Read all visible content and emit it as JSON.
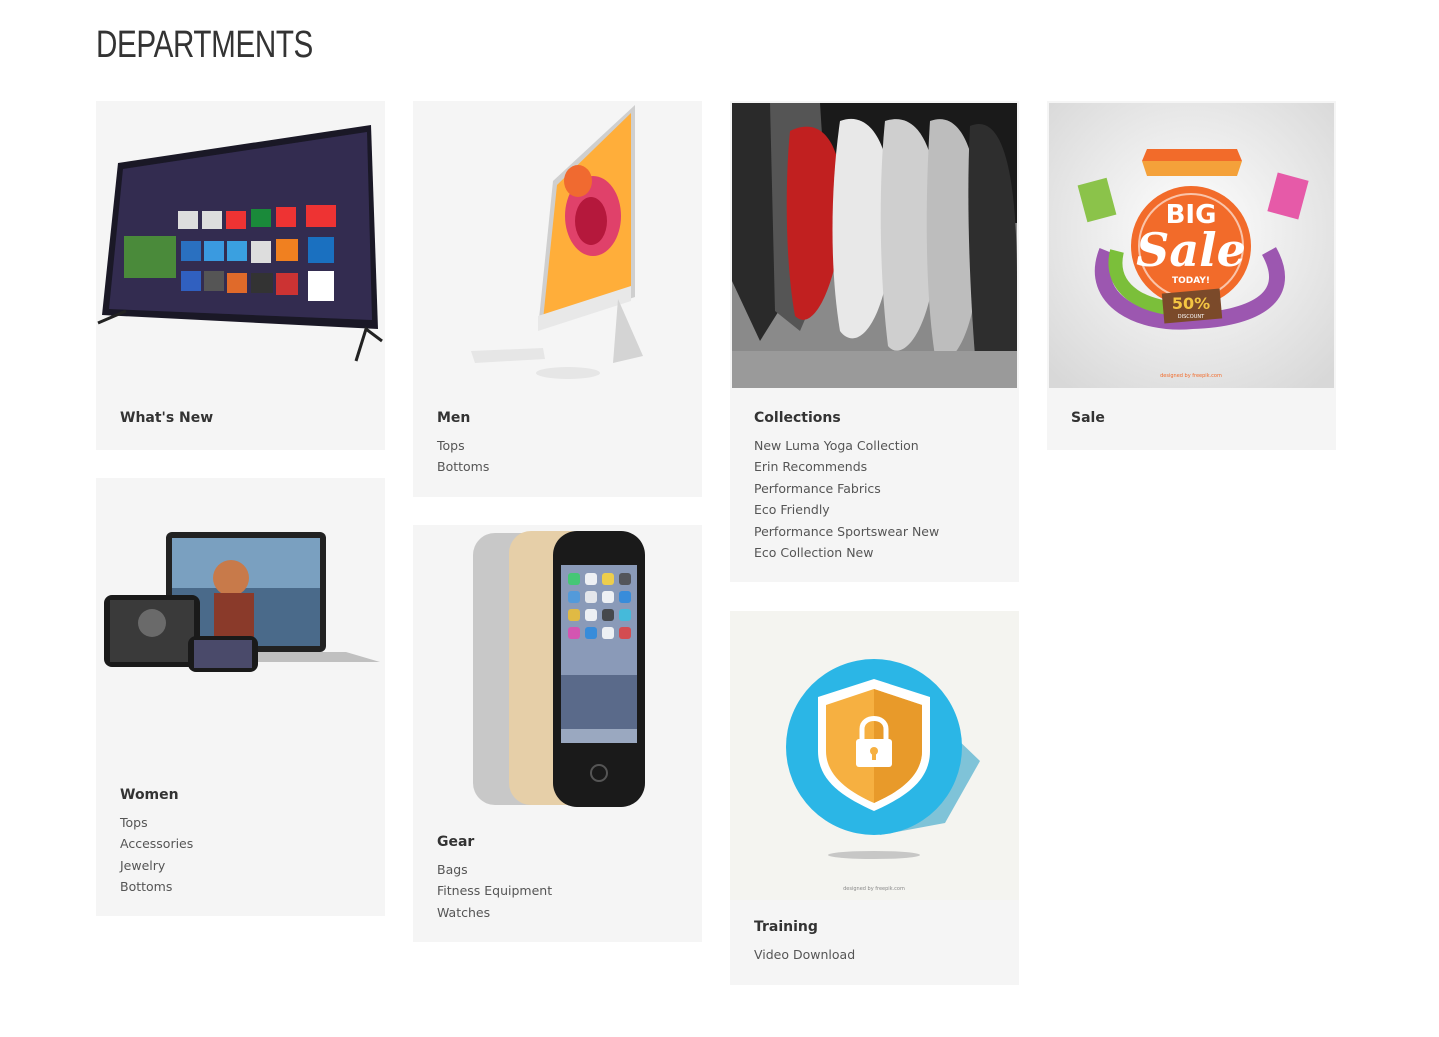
{
  "page": {
    "title": "DEPARTMENTS"
  },
  "departments": [
    {
      "title": "What's New",
      "image": "tv-icon",
      "links": []
    },
    {
      "title": "Men",
      "image": "desktop-computer-icon",
      "links": [
        "Tops",
        "Bottoms"
      ]
    },
    {
      "title": "Collections",
      "image": "sneakers-photo",
      "links": [
        "New Luma Yoga Collection",
        "Erin Recommends",
        "Performance Fabrics",
        "Eco Friendly",
        "Performance Sportswear New",
        "Eco Collection New"
      ]
    },
    {
      "title": "Sale",
      "image": "big-sale-illustration",
      "image_text": {
        "big": "BIG",
        "sale": "Sale",
        "today": "TODAY!",
        "discount": "50%",
        "discount_label": "DISCOUNT",
        "credit": "designed by freepik.com"
      },
      "links": []
    },
    {
      "title": "Women",
      "image": "devices-icon",
      "links": [
        "Tops",
        "Accessories",
        "Jewelry",
        "Bottoms"
      ]
    },
    {
      "title": "Gear",
      "image": "phones-icon",
      "links": [
        "Bags",
        "Fitness Equipment",
        "Watches"
      ]
    },
    {
      "title": "Training",
      "image": "security-shield-icon",
      "image_text": {
        "credit": "designed by freepik.com"
      },
      "links": [
        "Video Download"
      ]
    }
  ],
  "colors": {
    "card_bg": "#f5f5f5",
    "text": "#333333",
    "link": "#555555",
    "shield_blue": "#2bb6e6",
    "shield_orange": "#f6b041"
  }
}
